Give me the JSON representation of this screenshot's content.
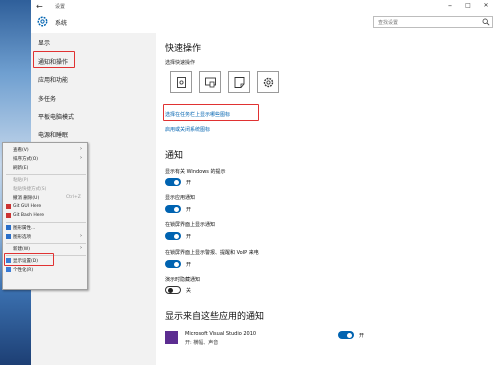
{
  "window": {
    "back_glyph": "←",
    "title": "设置",
    "minimize_glyph": "–",
    "maximize_glyph": "□",
    "close_glyph": "✕"
  },
  "header": {
    "title": "系统",
    "search_placeholder": "查找设置",
    "search_icon": "search-icon"
  },
  "sidebar": {
    "items": [
      {
        "label": "显示"
      },
      {
        "label": "通知和操作"
      },
      {
        "label": "应用和功能"
      },
      {
        "label": "多任务"
      },
      {
        "label": "平板电脑模式"
      },
      {
        "label": "电源和睡眠"
      }
    ]
  },
  "quick_actions": {
    "heading": "快速操作",
    "subheading": "选择快速操作",
    "tiles": [
      "tablet-icon",
      "connect-icon",
      "note-icon",
      "settings-icon"
    ],
    "link_taskbar_icons": "选择在任务栏上显示哪些图标",
    "link_system_icons": "启用或关闭系统图标"
  },
  "notifications": {
    "heading": "通知",
    "items": [
      {
        "label": "显示有关 Windows 的提示",
        "state": "开",
        "on": true
      },
      {
        "label": "显示应用通知",
        "state": "开",
        "on": true
      },
      {
        "label": "在锁屏界面上显示通知",
        "state": "开",
        "on": true
      },
      {
        "label": "在锁屏界面上显示警报、提醒和 VoIP 来电",
        "state": "开",
        "on": true
      },
      {
        "label": "演示时隐藏通知",
        "state": "关",
        "on": false
      }
    ]
  },
  "app_notifications": {
    "heading": "显示来自这些应用的通知",
    "apps": [
      {
        "name": "Microsoft Visual Studio 2010",
        "detail": "开: 横幅、声音",
        "state": "开",
        "on": true
      }
    ]
  },
  "context_menu": {
    "items": [
      {
        "label": "查看(V)",
        "arrow": "›"
      },
      {
        "label": "排序方式(O)",
        "arrow": "›"
      },
      {
        "label": "刷新(E)"
      },
      {
        "label": "粘贴(P)",
        "dim": true
      },
      {
        "label": "粘贴快捷方式(S)",
        "dim": true
      },
      {
        "label": "撤消 删除(U)",
        "shortcut": "Ctrl+Z"
      },
      {
        "label": "Git GUI Here"
      },
      {
        "label": "Git Bash Here"
      },
      {
        "label": "图形属性..."
      },
      {
        "label": "图形选项",
        "arrow": "›"
      },
      {
        "label": "新建(W)",
        "arrow": "›"
      },
      {
        "label": "显示设置(D)"
      },
      {
        "label": "个性化(R)"
      }
    ]
  },
  "colors": {
    "accent": "#0063b1",
    "highlight": "#e03232"
  }
}
